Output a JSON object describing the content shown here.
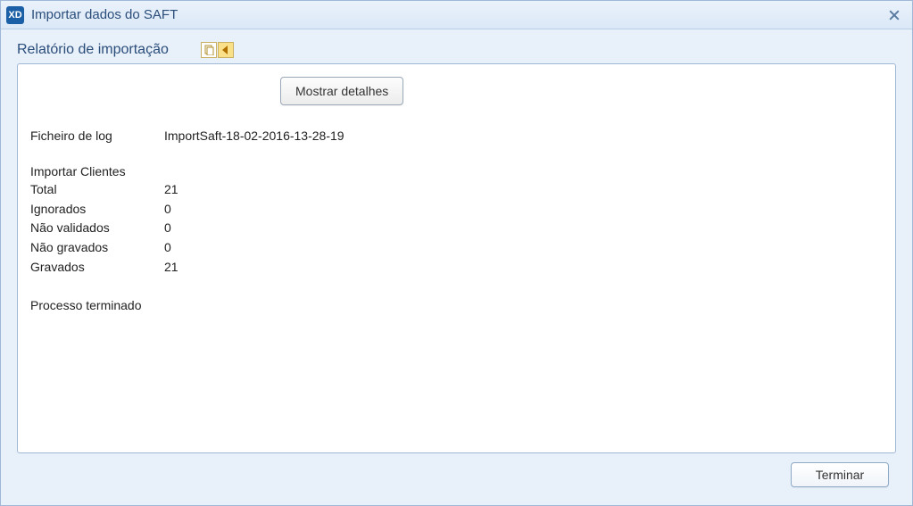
{
  "window": {
    "title": "Importar dados do SAFT",
    "app_icon_text": "XD"
  },
  "section": {
    "label": "Relatório de importação"
  },
  "buttons": {
    "show_details": "Mostrar detalhes",
    "finish": "Terminar"
  },
  "log": {
    "file_label": "Ficheiro de log",
    "file_name": "ImportSaft-18-02-2016-13-28-19"
  },
  "stats": {
    "heading": "Importar Clientes",
    "rows": [
      {
        "label": "Total",
        "value": "21"
      },
      {
        "label": "Ignorados",
        "value": "0"
      },
      {
        "label": "Não validados",
        "value": "0"
      },
      {
        "label": "Não gravados",
        "value": "0"
      },
      {
        "label": "Gravados",
        "value": "21"
      }
    ]
  },
  "status": {
    "done": "Processo terminado"
  }
}
